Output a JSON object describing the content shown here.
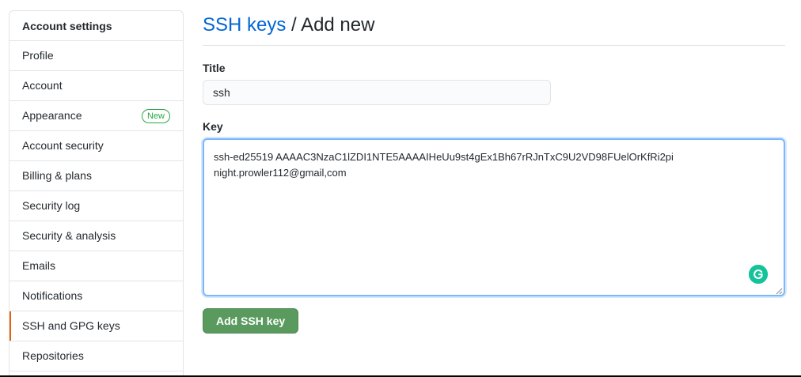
{
  "sidebar": {
    "header": "Account settings",
    "items": [
      {
        "label": "Profile"
      },
      {
        "label": "Account"
      },
      {
        "label": "Appearance",
        "badge": "New"
      },
      {
        "label": "Account security"
      },
      {
        "label": "Billing & plans"
      },
      {
        "label": "Security log"
      },
      {
        "label": "Security & analysis"
      },
      {
        "label": "Emails"
      },
      {
        "label": "Notifications"
      },
      {
        "label": "SSH and GPG keys",
        "selected": true
      },
      {
        "label": "Repositories"
      }
    ]
  },
  "breadcrumb": {
    "link": "SSH keys",
    "separator": " / ",
    "current": "Add new"
  },
  "form": {
    "title_label": "Title",
    "title_value": "ssh",
    "key_label": "Key",
    "key_value": "ssh-ed25519 AAAAC3NzaC1lZDI1NTE5AAAAIHeUu9st4gEx1Bh67rRJnTxC9U2VD98FUelOrKfRi2pi\nnight.prowler112@gmail,com",
    "submit_label": "Add SSH key"
  },
  "colors": {
    "selected_indicator": "#e36209",
    "link": "#0366d6",
    "submit_button": "#5a9a5f",
    "badge": "#28a745",
    "grammarly": "#15c39a"
  },
  "icons": {
    "grammarly": "grammarly-icon",
    "resize": "resize-handle-icon"
  }
}
